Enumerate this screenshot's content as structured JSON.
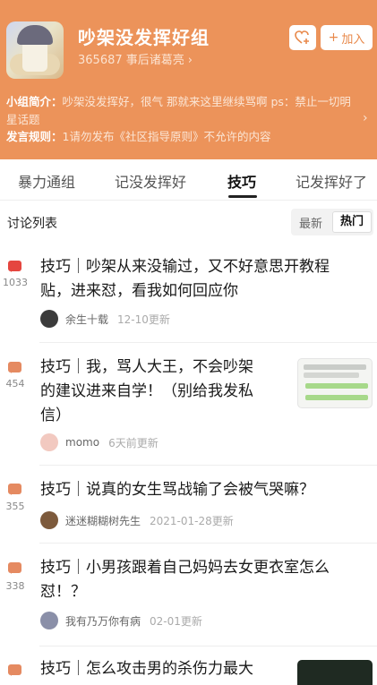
{
  "group": {
    "title": "吵架没发挥好组",
    "members": "365687",
    "owner": "事后诸葛亮",
    "fav_icon": "heart-plus-icon",
    "join_label": "加入",
    "intro_label": "小组简介：",
    "intro_text": "吵架没发挥好，很气 那就来这里继续骂啊 ps：禁止一切明星话题",
    "rule_label": "发言规则：",
    "rule_text": "1请勿发布《社区指导原则》不允许的内容"
  },
  "tabs": [
    "暴力通组",
    "记没发挥好",
    "技巧",
    "记发挥好了"
  ],
  "active_tab": 2,
  "list": {
    "title": "讨论列表",
    "sort_latest": "最新",
    "sort_hot": "热门"
  },
  "posts": [
    {
      "count": "1033",
      "hot": true,
      "lines": [
        "技巧｜吵架从来没输过，又不好意思开教程",
        "贴，进来怼，看我如何回应你"
      ],
      "author": "余生十载",
      "time": "12-10更新",
      "avatar_color": "#3b3b3b"
    },
    {
      "count": "454",
      "hot": false,
      "lines": [
        "技巧｜我，骂人大王，不会吵架",
        "的建议进来自学！（别给我发私",
        "信）"
      ],
      "author": "momo",
      "time": "6天前更新",
      "avatar_color": "#f2c9c0"
    },
    {
      "count": "355",
      "hot": false,
      "lines": [
        "技巧｜说真的女生骂战输了会被气哭嘛？"
      ],
      "author": "迷迷糊糊树先生",
      "time": "2021-01-28更新",
      "avatar_color": "#7d5a3c"
    },
    {
      "count": "338",
      "hot": false,
      "lines": [
        "技巧｜小男孩跟着自己妈妈去女更衣室怎么",
        "怼！？"
      ],
      "author": "我有乃万你有病",
      "time": "02-01更新",
      "avatar_color": "#8a8fa8"
    },
    {
      "count": "",
      "hot": false,
      "lines": [
        "技巧｜怎么攻击男的杀伤力最大"
      ],
      "author": "",
      "time": "",
      "avatar_color": "#cccccc"
    }
  ],
  "colors": {
    "header_bg": "#ec935a",
    "accent": "#e8894b",
    "hot_bubble": "#e5463f",
    "bubble": "#e58a61"
  }
}
